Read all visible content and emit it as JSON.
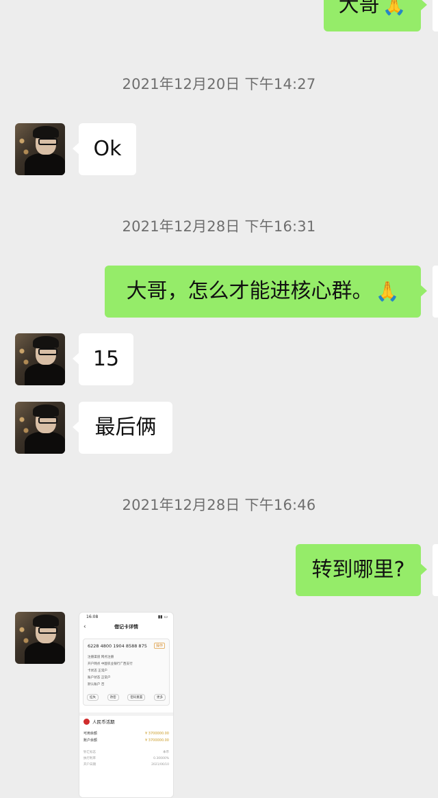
{
  "messages": {
    "m1": {
      "text": "大哥",
      "emoji": "🙏"
    },
    "ts1": "2021年12月20日 下午14:27",
    "m2": {
      "text": "Ok"
    },
    "ts2": "2021年12月28日 下午16:31",
    "m3": {
      "text": "大哥，怎么才能进核心群。",
      "emoji": "🙏"
    },
    "m4": {
      "text": "15"
    },
    "m5": {
      "text": "最后俩"
    },
    "ts3": "2021年12月28日 下午16:46",
    "m6": {
      "text": "转到哪里?"
    }
  },
  "screenshot": {
    "time": "16:08",
    "title": "借记卡详情",
    "card_number": "6228 4800 1904 8588 875",
    "card_tag": "操作",
    "rows": [
      "注册渠道  网点注册",
      "开户网点  中国农业银行广西支行",
      "卡状态  正常户",
      "账户状态  正常户",
      "默认账户  否"
    ],
    "buttons": [
      "挂失",
      "改密",
      "密码重置",
      "更多"
    ],
    "currency": "人民币活期",
    "available_label": "可用余额",
    "available_value": "¥ 3700000.00",
    "balance_label": "账户余额",
    "balance_value": "¥ 3700000.00",
    "extra": [
      [
        "钞汇标志",
        "本币"
      ],
      [
        "执行利率",
        "0.30000%"
      ],
      [
        "开户日期",
        "2021/06/10"
      ]
    ]
  },
  "colors": {
    "sent_bubble": "#95ec69",
    "recv_bubble": "#ffffff",
    "background": "#ededed"
  }
}
